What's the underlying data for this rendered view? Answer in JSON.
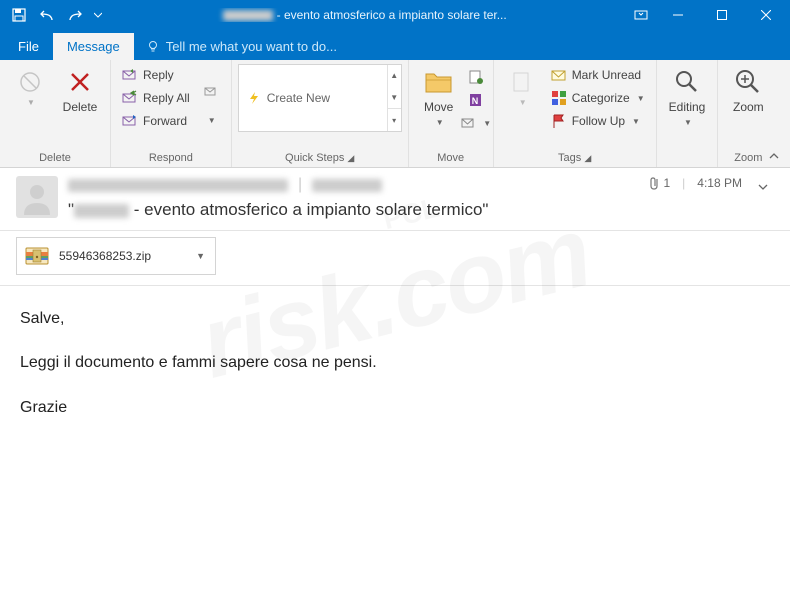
{
  "titlebar": {
    "title": "- evento atmosferico a impianto solare ter..."
  },
  "tabs": {
    "file": "File",
    "message": "Message",
    "tellme": "Tell me what you want to do..."
  },
  "ribbon": {
    "delete": {
      "label": "Delete",
      "group": "Delete"
    },
    "respond": {
      "reply": "Reply",
      "reply_all": "Reply All",
      "forward": "Forward",
      "group": "Respond"
    },
    "quicksteps": {
      "create_new": "Create New",
      "group": "Quick Steps"
    },
    "move": {
      "label": "Move",
      "group": "Move"
    },
    "tags": {
      "mark_unread": "Mark Unread",
      "categorize": "Categorize",
      "follow_up": "Follow Up",
      "group": "Tags"
    },
    "editing": {
      "label": "Editing"
    },
    "zoom": {
      "label": "Zoom",
      "group": "Zoom"
    }
  },
  "header": {
    "subject_prefix": "\"",
    "subject_suffix": " - evento atmosferico a impianto solare termico\"",
    "attachment_count": "1",
    "time": "4:18 PM"
  },
  "attachment": {
    "filename": "55946368253.zip"
  },
  "body": {
    "greeting": "Salve,",
    "line1": "Leggi il documento e fammi sapere cosa ne pensi.",
    "closing": "Grazie"
  },
  "watermark": {
    "main": "risk.com",
    "small": "PCL"
  }
}
